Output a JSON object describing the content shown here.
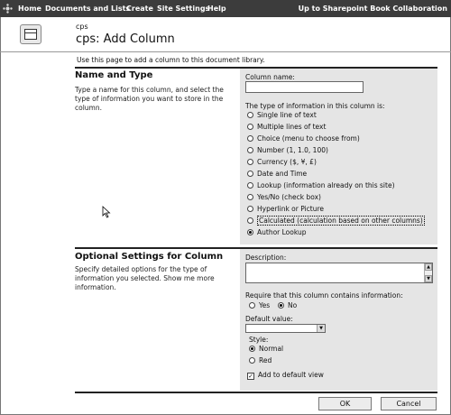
{
  "topnav": {
    "items": [
      "Home",
      "Documents and Lists",
      "Create",
      "Site Settings",
      "Help"
    ],
    "up_link": "Up to Sharepoint Book Collaboration"
  },
  "header": {
    "site": "cps",
    "title": "cps: Add Column"
  },
  "intro": "Use this page to add a column to this document library.",
  "name_type": {
    "title": "Name and Type",
    "description": "Type a name for this column, and select the type of information you want to store in the column.",
    "column_name_label": "Column name:",
    "column_name_value": "",
    "type_label": "The type of information in this column is:",
    "options": [
      "Single line of text",
      "Multiple lines of text",
      "Choice (menu to choose from)",
      "Number (1, 1.0, 100)",
      "Currency ($, ¥, £)",
      "Date and Time",
      "Lookup (information already on this site)",
      "Yes/No (check box)",
      "Hyperlink or Picture",
      "Calculated (calculation based on other columns)",
      "Author Lookup"
    ],
    "selected_option": "Author Lookup"
  },
  "optional": {
    "title": "Optional Settings for Column",
    "description": "Specify detailed options for the type of information you selected. Show me more information.",
    "description_label": "Description:",
    "require_label": "Require that this column contains information:",
    "require_yes": "Yes",
    "require_no": "No",
    "require_selected": "No",
    "default_label": "Default value:",
    "default_value": "",
    "style_label": "Style:",
    "style_normal": "Normal",
    "style_red": "Red",
    "style_selected": "Normal",
    "add_default_view": "Add to default view",
    "add_default_view_checked": true
  },
  "buttons": {
    "ok": "OK",
    "cancel": "Cancel"
  }
}
